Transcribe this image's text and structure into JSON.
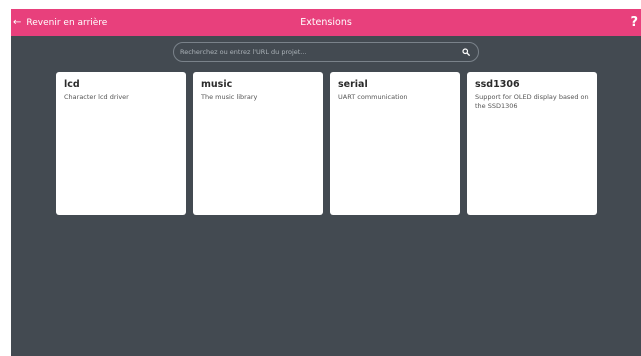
{
  "header": {
    "back_label": "Revenir en arrière",
    "back_icon": "arrow-left-icon",
    "title": "Extensions",
    "help_label": "?",
    "color": "#e8407c"
  },
  "search": {
    "placeholder": "Recherchez ou entrez l'URL du projet...",
    "value": "",
    "icon": "search-icon"
  },
  "extensions": [
    {
      "name": "lcd",
      "description": "Character lcd driver"
    },
    {
      "name": "music",
      "description": "The music library"
    },
    {
      "name": "serial",
      "description": "UART communication"
    },
    {
      "name": "ssd1306",
      "description": "Support for OLED display based on the SSD1306"
    }
  ],
  "colors": {
    "background": "#434a51",
    "card": "#ffffff",
    "accent": "#e8407c"
  }
}
